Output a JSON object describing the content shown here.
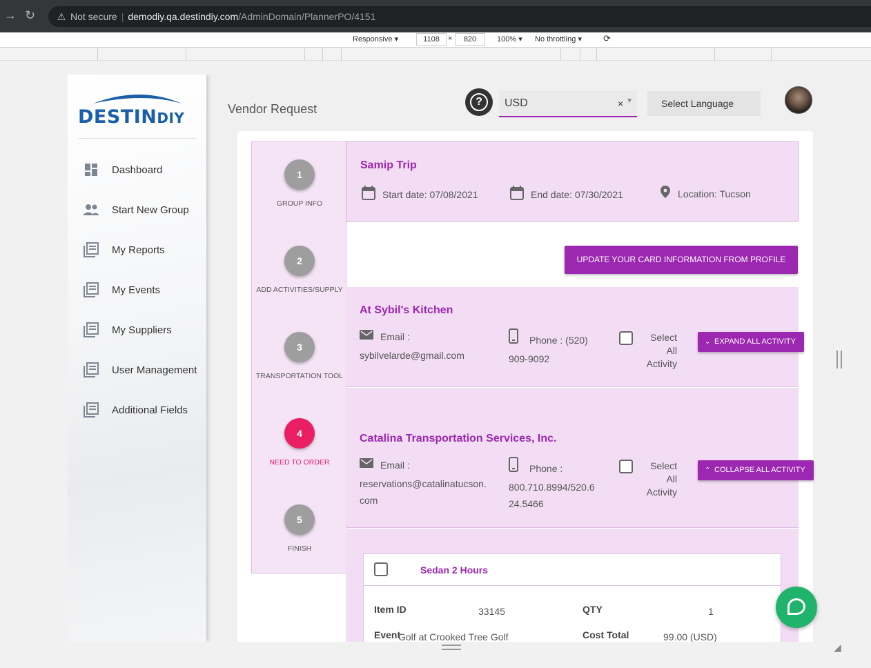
{
  "browser": {
    "security_label": "Not secure",
    "url_host": "demodiy.qa.destindiy.com",
    "url_path": "/AdminDomain/PlannerPO/4151"
  },
  "devtools": {
    "device": "Responsive ▾",
    "width": "1108",
    "height": "820",
    "times": "×",
    "zoom": "100% ▾",
    "throttling": "No throttling ▾"
  },
  "sidebar": {
    "logo_main": "DESTIN",
    "logo_sub": "DIY",
    "items": [
      {
        "label": "Dashboard",
        "icon": "dashboard-icon"
      },
      {
        "label": "Start New Group",
        "icon": "group-icon"
      },
      {
        "label": "My Reports",
        "icon": "library-books-icon"
      },
      {
        "label": "My Events",
        "icon": "library-books-icon"
      },
      {
        "label": "My Suppliers",
        "icon": "library-books-icon"
      },
      {
        "label": "User Management",
        "icon": "library-books-icon"
      },
      {
        "label": "Additional Fields",
        "icon": "library-books-icon"
      }
    ]
  },
  "header": {
    "page_title": "Vendor Request",
    "currency": "USD",
    "currency_clear": "×",
    "language_button": "Select Language"
  },
  "stepper": {
    "steps": [
      {
        "num": "1",
        "label": "GROUP INFO"
      },
      {
        "num": "2",
        "label": "ADD ACTIVITIES/SUPPLY"
      },
      {
        "num": "3",
        "label": "TRANSPORTATION TOOL"
      },
      {
        "num": "4",
        "label": "NEED TO ORDER"
      },
      {
        "num": "5",
        "label": "FINISH"
      }
    ],
    "active_step": 4
  },
  "trip": {
    "title": "Samip Trip",
    "start": "Start date: 07/08/2021",
    "end": "End date: 07/30/2021",
    "location": "Location:  Tucson"
  },
  "actions": {
    "update_card": "UPDATE YOUR CARD INFORMATION FROM PROFILE"
  },
  "vendors": [
    {
      "name": "At Sybil's Kitchen",
      "email_label": "Email :",
      "email": "sybilvelarde@gmail.com",
      "phone_line1": "Phone : (520)",
      "phone_line2": "909-9092",
      "select_all": [
        "Select",
        "All",
        "Activity"
      ],
      "button": "EXPAND ALL ACTIVITY"
    },
    {
      "name": "Catalina Transportation Services, Inc.",
      "email_label": "Email :",
      "email_line1": "reservations@catalinatucson.",
      "email_line2": "com",
      "phone_line1": "Phone :",
      "phone_line2": "800.710.8994/520.6",
      "phone_line3": "24.5466",
      "select_all": [
        "Select",
        "All",
        "Activity"
      ],
      "button": "COLLAPSE ALL ACTIVITY"
    }
  ],
  "item": {
    "title": "Sedan 2 Hours",
    "item_id_label": "Item ID",
    "item_id": "33145",
    "qty_label": "QTY",
    "qty": "1",
    "event_label": "Event",
    "event": "Golf at Crooked Tree Golf",
    "cost_label": "Cost Total",
    "cost": "99.00 (USD)"
  },
  "colors": {
    "accent": "#9c27b0",
    "active_step": "#e91e63",
    "chat": "#1fb36b"
  }
}
